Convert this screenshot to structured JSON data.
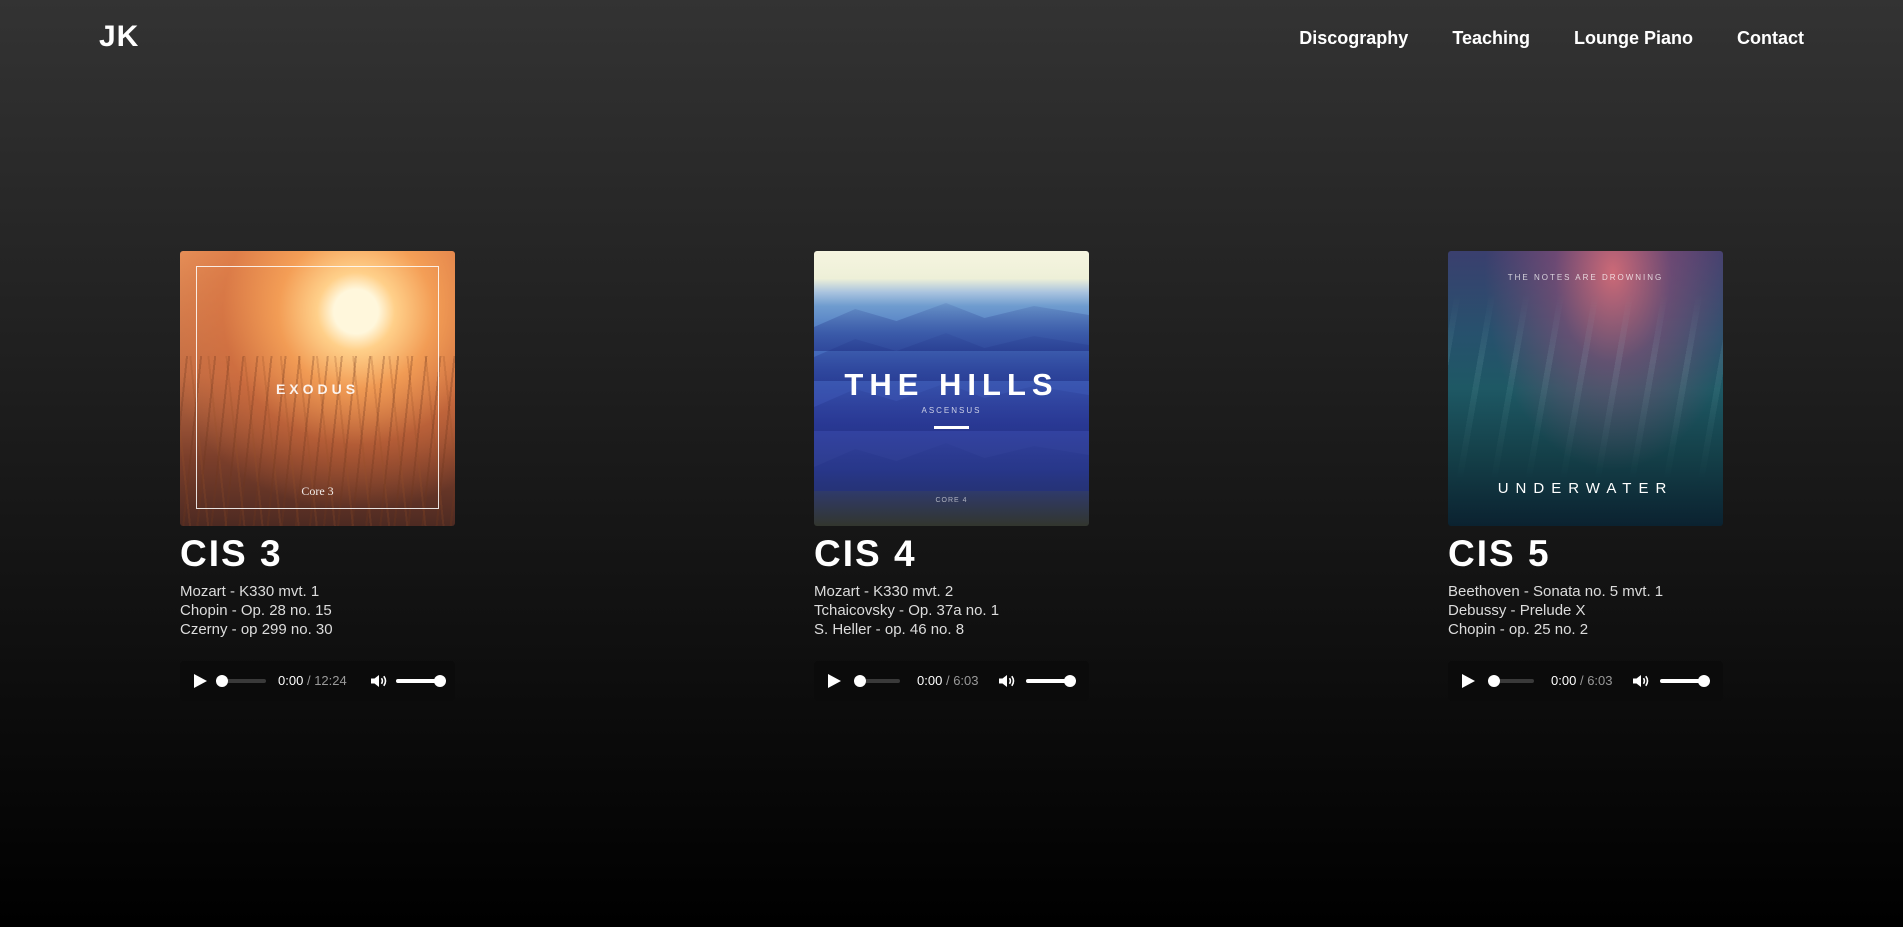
{
  "header": {
    "logo": "JK",
    "nav": [
      "Discography",
      "Teaching",
      "Lounge Piano",
      "Contact"
    ]
  },
  "albums": [
    {
      "title": "CIS 3",
      "cover": {
        "main_text": "EXODUS",
        "sub_text": "Core 3",
        "icon": "album-cover-sunset-reeds"
      },
      "tracks": [
        "Mozart - K330 mvt. 1",
        "Chopin - Op. 28 no. 15",
        "Czerny - op 299 no. 30"
      ],
      "player": {
        "current": "0:00",
        "separator": "/",
        "duration": "12:24",
        "progress": 0,
        "volume": 1
      }
    },
    {
      "title": "CIS 4",
      "cover": {
        "main_text": "THE HILLS",
        "sub_text": "ASCENSUS",
        "footer_text": "CORE 4",
        "icon": "album-cover-blue-hills"
      },
      "tracks": [
        "Mozart - K330 mvt. 2",
        "Tchaicovsky - Op. 37a no. 1",
        "S. Heller - op. 46 no. 8"
      ],
      "player": {
        "current": "0:00",
        "separator": "/",
        "duration": "6:03",
        "progress": 0,
        "volume": 1
      }
    },
    {
      "title": "CIS 5",
      "cover": {
        "top_text": "THE NOTES ARE DROWNING",
        "main_text": "UNDERWATER",
        "icon": "album-cover-underwater"
      },
      "tracks": [
        "Beethoven - Sonata no. 5 mvt. 1",
        "Debussy - Prelude X",
        "Chopin - op. 25 no. 2"
      ],
      "player": {
        "current": "0:00",
        "separator": "/",
        "duration": "6:03",
        "progress": 0,
        "volume": 1
      }
    }
  ],
  "colors": {
    "background_top": "#333333",
    "background_bottom": "#000000",
    "player_bg": "#0b0b0b",
    "text": "#ffffff",
    "track_text": "#dcdcdc"
  }
}
